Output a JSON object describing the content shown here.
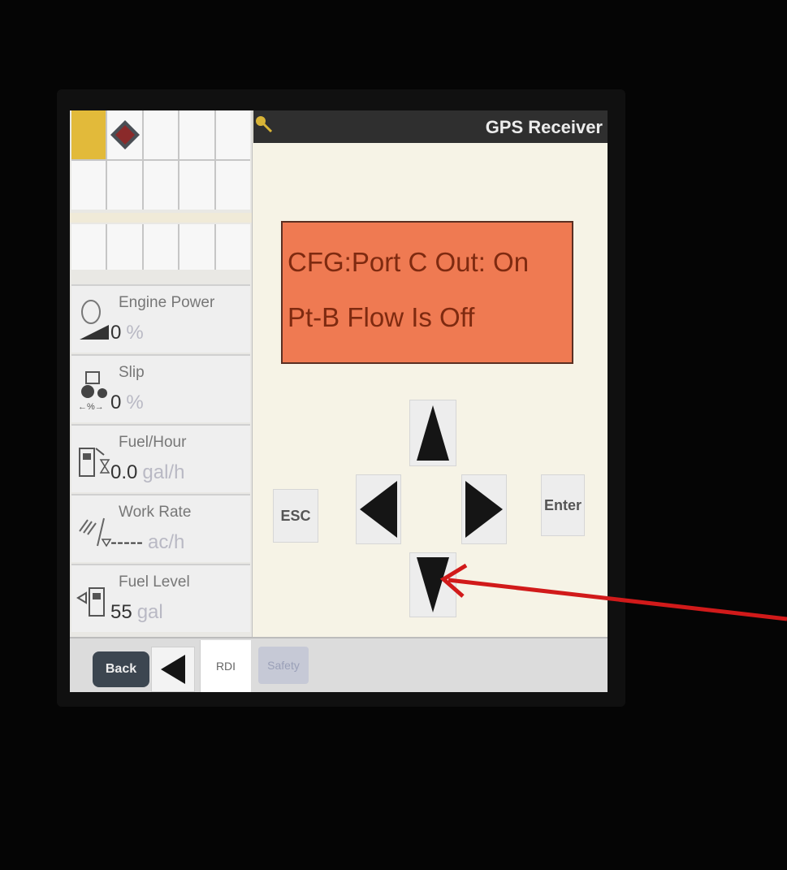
{
  "header": {
    "title": "GPS Receiver"
  },
  "left_column": {
    "metrics": [
      {
        "label": "Engine Power",
        "value": "0",
        "unit": "%"
      },
      {
        "label": "Slip",
        "value": "0",
        "unit": "%"
      },
      {
        "label": "Fuel/Hour",
        "value": "0.0",
        "unit": "gal/h"
      },
      {
        "label": "Work Rate",
        "value": "-----",
        "unit": "ac/h"
      },
      {
        "label": "Fuel Level",
        "value": "55",
        "unit": "gal"
      }
    ]
  },
  "status": {
    "line1": "CFG:Port C Out: On",
    "line2": "Pt-B Flow Is Off"
  },
  "keypad": {
    "esc_label": "ESC",
    "enter_label": "Enter"
  },
  "bottom_tabs": {
    "back_label": "Back",
    "rdi_label": "RDI",
    "safety_label": "Safety"
  },
  "colors": {
    "status_bg": "#ef7a52",
    "status_text": "#7e2a10",
    "selected_cell": "#e2ba3a",
    "annotation_arrow": "#d11a1a"
  }
}
